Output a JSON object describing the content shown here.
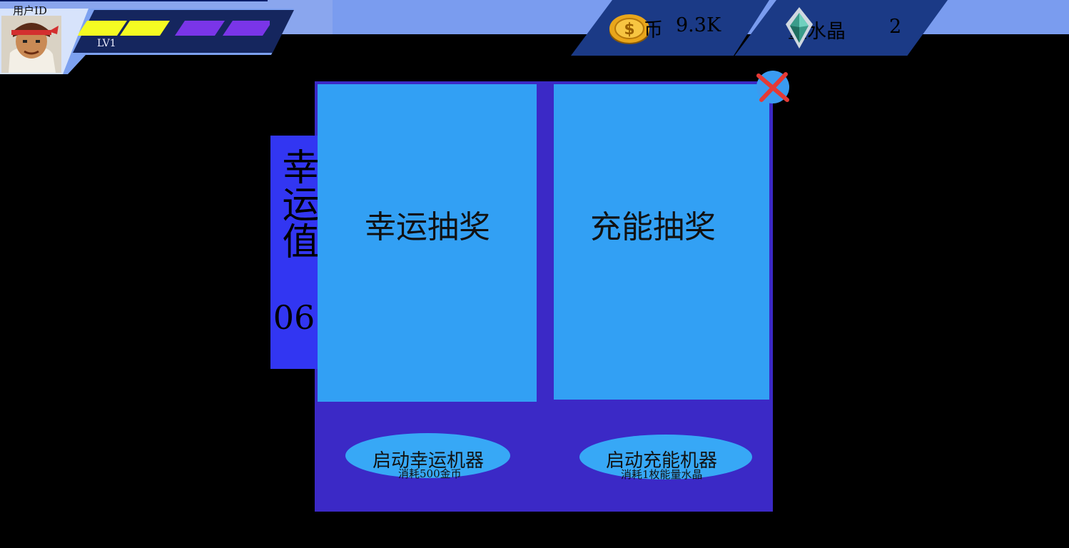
{
  "player": {
    "id_label": "用户ID",
    "level": "LV1",
    "exp_segments": [
      "#f4fb22",
      "#f4fb22",
      "#7a35e8",
      "#7a35e8"
    ]
  },
  "currencies": {
    "coin": {
      "label": "币",
      "value": "9.3K",
      "icon": "gold-coin-icon"
    },
    "crystal": {
      "label": "量水晶",
      "value": "2",
      "icon": "crystal-icon"
    }
  },
  "lottery": {
    "luck_label": "幸运值",
    "luck_value": "06",
    "lucky": {
      "title": "幸运抽奖",
      "button_label": "启动幸运机器",
      "cost": "消耗500金币"
    },
    "charge": {
      "title": "充能抽奖",
      "button_label": "启动充能机器",
      "cost": "消耗1枚能量水晶"
    }
  },
  "colors": {
    "panel": "#3b29c6",
    "tile": "#32a0f4",
    "luck_bar": "#3236f2",
    "topbar": "#7a9cef",
    "currency_box": "#1b3a86",
    "close_x": "#e53935"
  }
}
